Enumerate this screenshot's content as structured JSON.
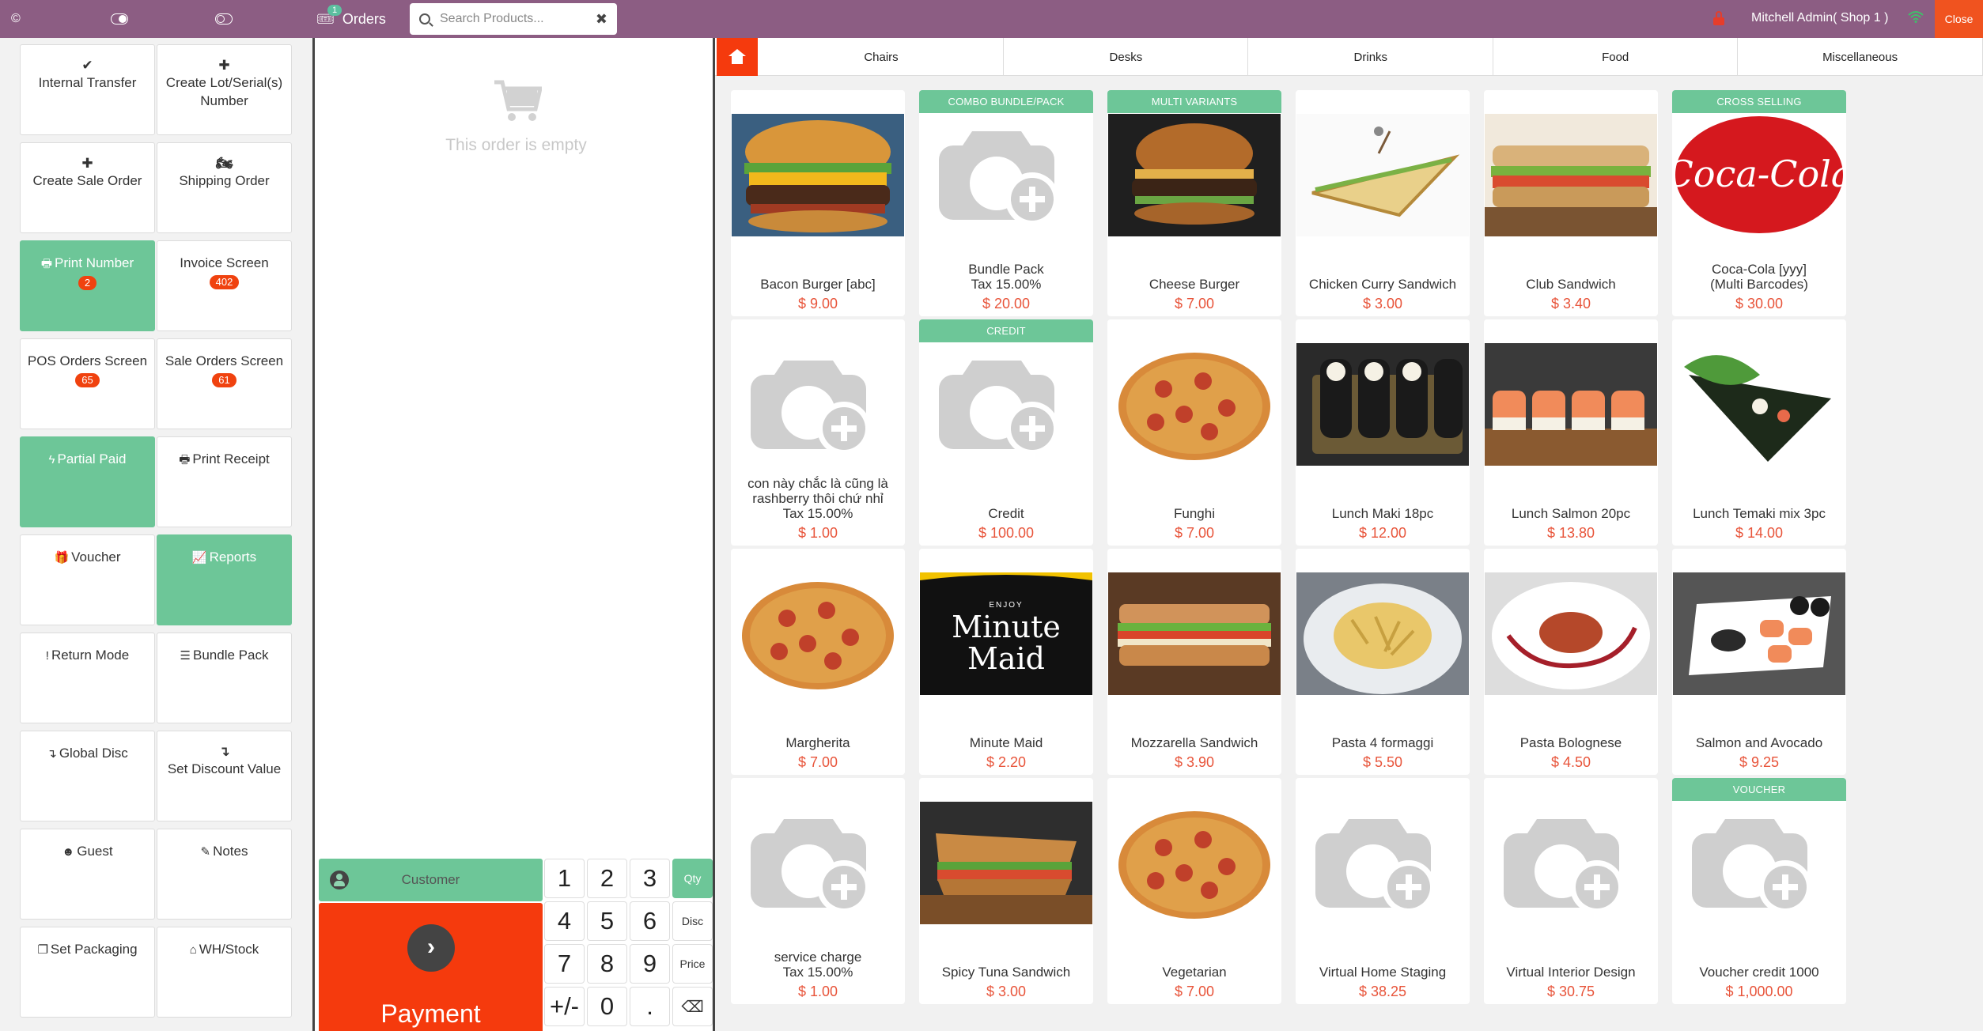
{
  "topbar": {
    "orders_label": "Orders",
    "orders_count": "1",
    "search_placeholder": "Search Products...",
    "user": "Mitchell Admin( Shop 1 )",
    "close_label": "Close"
  },
  "actions": [
    {
      "icon": "✔",
      "label": "Internal Transfer"
    },
    {
      "icon": "✚",
      "label": "Create Lot/Serial(s) Number"
    },
    {
      "icon": "✚",
      "label": "Create Sale Order"
    },
    {
      "icon": "🏍",
      "label": "Shipping Order"
    },
    {
      "icon": "🖶",
      "label": "Print Number",
      "badge": "2"
    },
    {
      "label": "Invoice Screen",
      "badge": "402"
    },
    {
      "label": "POS Orders Screen",
      "badge": "65"
    },
    {
      "label": "Sale Orders Screen",
      "badge": "61"
    },
    {
      "icon": "ϟ",
      "label": "Partial Paid"
    },
    {
      "icon": "🖶",
      "label": "Print Receipt"
    },
    {
      "icon": "🎁",
      "label": "Voucher"
    },
    {
      "icon": "📈",
      "label": "Reports"
    },
    {
      "icon": "!",
      "label": "Return Mode"
    },
    {
      "icon": "☰",
      "label": "Bundle Pack"
    },
    {
      "icon": "↴",
      "label": "Global Disc"
    },
    {
      "icon": "↴",
      "label": "Set Discount Value"
    },
    {
      "icon": "☻",
      "label": "Guest"
    },
    {
      "icon": "✎",
      "label": "Notes"
    },
    {
      "icon": "❐",
      "label": "Set Packaging"
    },
    {
      "icon": "⌂",
      "label": "WH/Stock"
    }
  ],
  "order": {
    "empty_text": "This order is empty",
    "customer_label": "Customer",
    "payment_label": "Payment"
  },
  "numpad": {
    "keys": [
      "1",
      "2",
      "3",
      "Qty",
      "4",
      "5",
      "6",
      "Disc",
      "7",
      "8",
      "9",
      "Price",
      "+/-",
      "0",
      ".",
      "⌫"
    ]
  },
  "categories": [
    "Chairs",
    "Desks",
    "Drinks",
    "Food",
    "Miscellaneous"
  ],
  "products": [
    {
      "name": "Bacon Burger [abc]",
      "price": "$ 9.00",
      "img": "burger"
    },
    {
      "name": "Bundle Pack",
      "tax": "Tax 15.00%",
      "price": "$ 20.00",
      "img": "placeholder",
      "ribbon": "COMBO BUNDLE/PACK"
    },
    {
      "name": "Cheese Burger",
      "price": "$ 7.00",
      "img": "burger-dark",
      "ribbon": "MULTI VARIANTS"
    },
    {
      "name": "Chicken Curry Sandwich",
      "price": "$ 3.00",
      "img": "sandwich-tri"
    },
    {
      "name": "Club Sandwich",
      "price": "$ 3.40",
      "img": "club"
    },
    {
      "name": "Coca-Cola [yyy]",
      "variant": "(Multi Barcodes)",
      "price": "$ 30.00",
      "img": "coke",
      "ribbon": "CROSS SELLING"
    },
    {
      "name": "con này chắc là cũng là rashberry thôi chứ nhỉ",
      "tax": "Tax 15.00%",
      "price": "$ 1.00",
      "img": "placeholder"
    },
    {
      "name": "Credit",
      "price": "$ 100.00",
      "img": "placeholder",
      "ribbon": "CREDIT"
    },
    {
      "name": "Funghi",
      "price": "$ 7.00",
      "img": "pizza"
    },
    {
      "name": "Lunch Maki 18pc",
      "price": "$ 12.00",
      "img": "maki"
    },
    {
      "name": "Lunch Salmon 20pc",
      "price": "$ 13.80",
      "img": "salmon"
    },
    {
      "name": "Lunch Temaki mix 3pc",
      "price": "$ 14.00",
      "img": "temaki"
    },
    {
      "name": "Margherita",
      "price": "$ 7.00",
      "img": "pizza"
    },
    {
      "name": "Minute Maid",
      "price": "$ 2.20",
      "img": "minutemaid",
      "logo_text": "Minute Maid",
      "logo_small": "ENJOY"
    },
    {
      "name": "Mozzarella Sandwich",
      "price": "$ 3.90",
      "img": "mozza"
    },
    {
      "name": "Pasta 4 formaggi",
      "price": "$ 5.50",
      "img": "pasta"
    },
    {
      "name": "Pasta Bolognese",
      "price": "$ 4.50",
      "img": "bolognese"
    },
    {
      "name": "Salmon and Avocado",
      "price": "$ 9.25",
      "img": "sushiplate"
    },
    {
      "name": "service charge",
      "tax": "Tax 15.00%",
      "price": "$ 1.00",
      "img": "placeholder"
    },
    {
      "name": "Spicy Tuna Sandwich",
      "price": "$ 3.00",
      "img": "panini"
    },
    {
      "name": "Vegetarian",
      "price": "$ 7.00",
      "img": "pizza"
    },
    {
      "name": "Virtual Home Staging",
      "price": "$ 38.25",
      "img": "placeholder"
    },
    {
      "name": "Virtual Interior Design",
      "price": "$ 30.75",
      "img": "placeholder"
    },
    {
      "name": "Voucher credit 1000",
      "price": "$ 1,000.00",
      "img": "placeholder",
      "ribbon": "VOUCHER"
    }
  ]
}
